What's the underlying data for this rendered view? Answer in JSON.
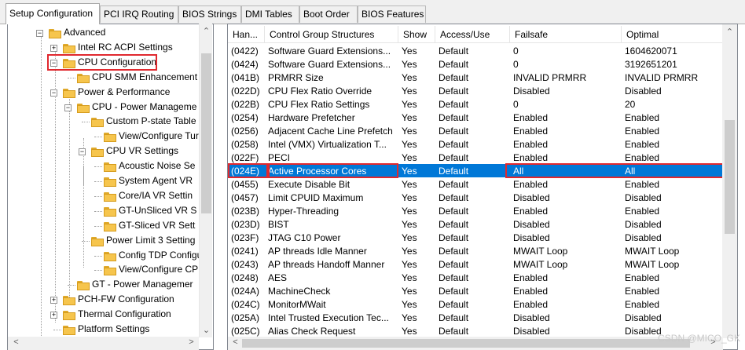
{
  "tabs": [
    "Setup Configuration",
    "PCI IRQ Routing",
    "BIOS Strings",
    "DMI Tables",
    "Boot Order",
    "BIOS Features"
  ],
  "tree": [
    {
      "label": "Advanced",
      "expander": "−"
    },
    {
      "label": "Intel RC ACPI Settings",
      "expander": "+"
    },
    {
      "label": "CPU Configuration",
      "expander": "−",
      "highlighted": true
    },
    {
      "label": "CPU SMM Enhancement",
      "expander": ""
    },
    {
      "label": "Power & Performance",
      "expander": "−"
    },
    {
      "label": "CPU - Power Manageme",
      "expander": "−"
    },
    {
      "label": "Custom P-state Table",
      "expander": ""
    },
    {
      "label": "View/Configure Tur",
      "expander": ""
    },
    {
      "label": "CPU VR Settings",
      "expander": "−"
    },
    {
      "label": "Acoustic Noise Se",
      "expander": ""
    },
    {
      "label": "System Agent VR",
      "expander": ""
    },
    {
      "label": "Core/IA VR Settin",
      "expander": ""
    },
    {
      "label": "GT-UnSliced VR S",
      "expander": ""
    },
    {
      "label": "GT-Sliced VR Sett",
      "expander": ""
    },
    {
      "label": "Power Limit 3 Setting",
      "expander": ""
    },
    {
      "label": "Config TDP Configu",
      "expander": ""
    },
    {
      "label": "View/Configure CPU",
      "expander": ""
    },
    {
      "label": "GT - Power Managemer",
      "expander": ""
    },
    {
      "label": "PCH-FW Configuration",
      "expander": "+"
    },
    {
      "label": "Thermal Configuration",
      "expander": "+"
    },
    {
      "label": "Platform Settings",
      "expander": ""
    }
  ],
  "columns": [
    "Han...",
    "Control Group Structures",
    "Show",
    "Access/Use",
    "Failsafe",
    "Optimal"
  ],
  "rows": [
    [
      "(0422)",
      "Software Guard Extensions...",
      "Yes",
      "Default",
      "0",
      "1604620071"
    ],
    [
      "(0424)",
      "Software Guard Extensions...",
      "Yes",
      "Default",
      "0",
      "3192651201"
    ],
    [
      "(041B)",
      "PRMRR Size",
      "Yes",
      "Default",
      "INVALID PRMRR",
      "INVALID PRMRR"
    ],
    [
      "(022D)",
      "CPU Flex Ratio Override",
      "Yes",
      "Default",
      "Disabled",
      "Disabled"
    ],
    [
      "(022B)",
      "CPU Flex Ratio Settings",
      "Yes",
      "Default",
      "0",
      "20"
    ],
    [
      "(0254)",
      "Hardware Prefetcher",
      "Yes",
      "Default",
      "Enabled",
      "Enabled"
    ],
    [
      "(0256)",
      "Adjacent Cache Line Prefetch",
      "Yes",
      "Default",
      "Enabled",
      "Enabled"
    ],
    [
      "(0258)",
      "Intel (VMX) Virtualization T...",
      "Yes",
      "Default",
      "Enabled",
      "Enabled"
    ],
    [
      "(022F)",
      "PECI",
      "Yes",
      "Default",
      "Enabled",
      "Enabled"
    ],
    [
      "(024E)",
      "Active Processor Cores",
      "Yes",
      "Default",
      "All",
      "All"
    ],
    [
      "(0455)",
      "Execute Disable Bit",
      "Yes",
      "Default",
      "Enabled",
      "Enabled"
    ],
    [
      "(0457)",
      "Limit CPUID Maximum",
      "Yes",
      "Default",
      "Disabled",
      "Disabled"
    ],
    [
      "(023B)",
      "Hyper-Threading",
      "Yes",
      "Default",
      "Enabled",
      "Enabled"
    ],
    [
      "(023D)",
      "BIST",
      "Yes",
      "Default",
      "Disabled",
      "Disabled"
    ],
    [
      "(023F)",
      "JTAG C10 Power",
      "Yes",
      "Default",
      "Disabled",
      "Disabled"
    ],
    [
      "(0241)",
      "AP threads Idle Manner",
      "Yes",
      "Default",
      "MWAIT Loop",
      "MWAIT Loop"
    ],
    [
      "(0243)",
      "AP threads Handoff Manner",
      "Yes",
      "Default",
      "MWAIT Loop",
      "MWAIT Loop"
    ],
    [
      "(0248)",
      "AES",
      "Yes",
      "Default",
      "Enabled",
      "Enabled"
    ],
    [
      "(024A)",
      "MachineCheck",
      "Yes",
      "Default",
      "Enabled",
      "Enabled"
    ],
    [
      "(024C)",
      "MonitorMWait",
      "Yes",
      "Default",
      "Enabled",
      "Enabled"
    ],
    [
      "(025A)",
      "Intel Trusted Execution Tec...",
      "Yes",
      "Default",
      "Disabled",
      "Disabled"
    ],
    [
      "(025C)",
      "Alias Check Request",
      "Yes",
      "Default",
      "Disabled",
      "Disabled"
    ]
  ],
  "selected_row": 9,
  "watermark": "CSDN @MICO_GK",
  "colors": {
    "selection": "#0078d7",
    "highlight_box": "#e0282e",
    "folder": "#f6c54d"
  }
}
